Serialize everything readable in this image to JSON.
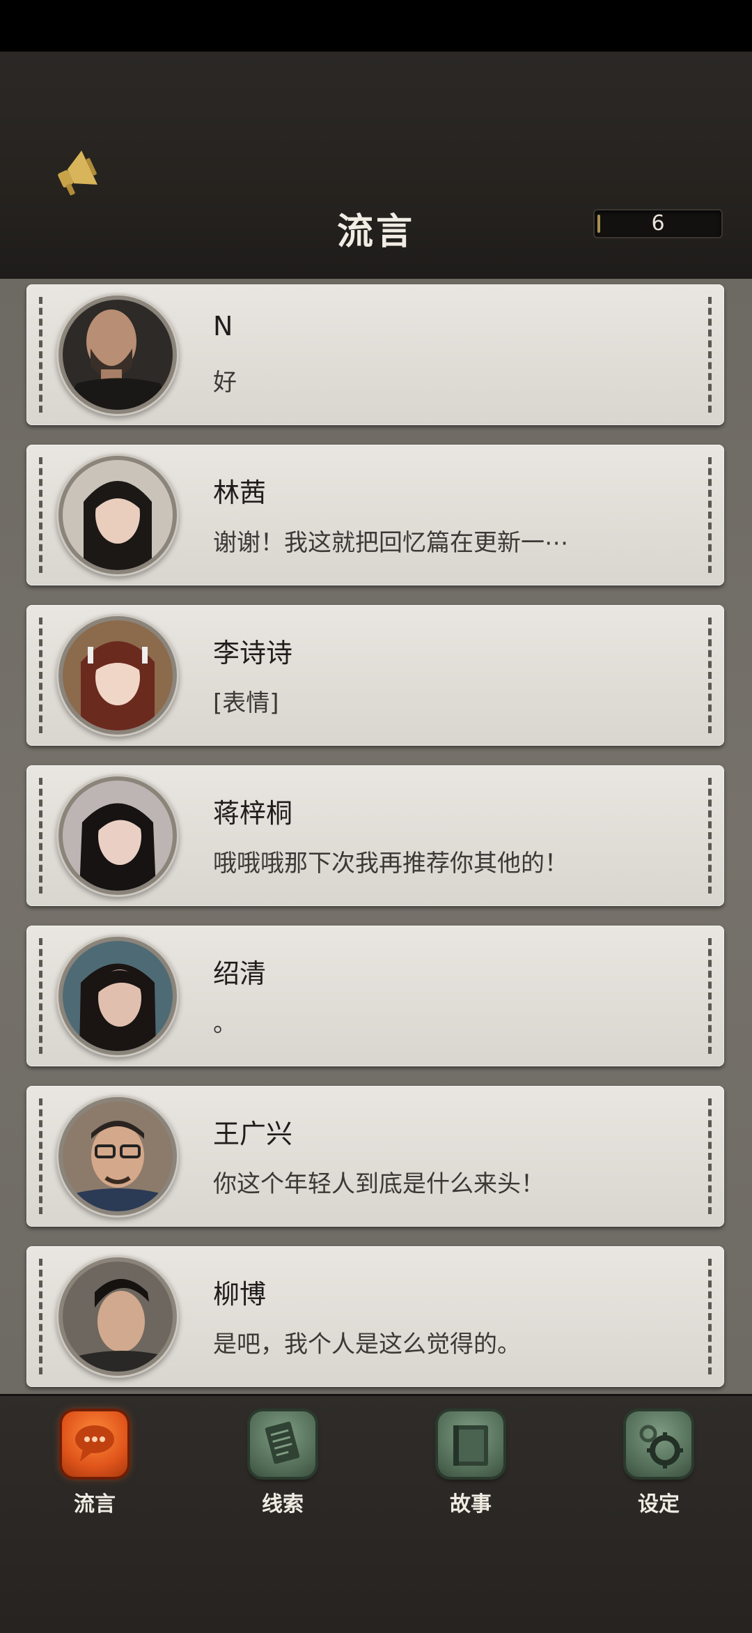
{
  "header": {
    "title": "流言",
    "counter_value": "6"
  },
  "messages": [
    {
      "name": "N",
      "preview": "好",
      "avatar": "man-dark-beard"
    },
    {
      "name": "林茜",
      "preview": "谢谢！我这就把回忆篇在更新一⋯",
      "avatar": "woman-long-hair"
    },
    {
      "name": "李诗诗",
      "preview": "[表情]",
      "avatar": "woman-red-hair"
    },
    {
      "name": "蒋梓桐",
      "preview": "哦哦哦那下次我再推荐你其他的！",
      "avatar": "woman-long-hair"
    },
    {
      "name": "绍清",
      "preview": "。",
      "avatar": "woman-dark-hair"
    },
    {
      "name": "王广兴",
      "preview": "你这个年轻人到底是什么来头！",
      "avatar": "man-glasses"
    },
    {
      "name": "柳博",
      "preview": "是吧，我个人是这么觉得的。",
      "avatar": "man-slick-hair"
    }
  ],
  "nav": {
    "items": [
      {
        "label": "流言",
        "icon": "chat-bubbles-icon",
        "active": true
      },
      {
        "label": "线索",
        "icon": "paper-note-icon",
        "active": false
      },
      {
        "label": "故事",
        "icon": "book-icon",
        "active": false
      },
      {
        "label": "设定",
        "icon": "gear-icon",
        "active": false
      }
    ]
  },
  "colors": {
    "active_tab": "#e0551b",
    "inactive_tab": "#506a55",
    "counter_accent": "#a8904f"
  }
}
